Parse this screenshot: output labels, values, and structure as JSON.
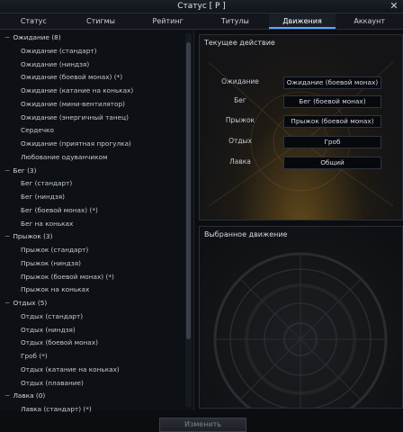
{
  "window": {
    "title": "Статус [ P ]",
    "close_icon": "close-icon"
  },
  "tabs": [
    {
      "label": "Статус",
      "active": false
    },
    {
      "label": "Стигмы",
      "active": false
    },
    {
      "label": "Рейтинг",
      "active": false
    },
    {
      "label": "Титулы",
      "active": false
    },
    {
      "label": "Движения",
      "active": true
    },
    {
      "label": "Аккаунт",
      "active": false
    }
  ],
  "motion_list": {
    "toggle_icon": "minus-icon",
    "groups": [
      {
        "label": "Ожидание (8)",
        "items": [
          "Ожидание (стандарт)",
          "Ожидание (ниндзя)",
          "Ожидание (боевой монах) (*)",
          "Ожидание (катание на коньках)",
          "Ожидание (мини-вентилятор)",
          "Ожидание (энергичный танец)",
          "Сердечко",
          "Ожидание (приятная прогулка)",
          "Любование одуванчиком"
        ]
      },
      {
        "label": "Бег (3)",
        "items": [
          "Бег (стандарт)",
          "Бег (ниндзя)",
          "Бег (боевой монах) (*)",
          "Бег на коньках"
        ]
      },
      {
        "label": "Прыжок (3)",
        "items": [
          "Прыжок (стандарт)",
          "Прыжок (ниндзя)",
          "Прыжок (боевой монах) (*)",
          "Прыжок на коньках"
        ]
      },
      {
        "label": "Отдых (5)",
        "items": [
          "Отдых (стандарт)",
          "Отдых (ниндзя)",
          "Отдых (боевой монах)",
          "Гроб (*)",
          "Отдых (катание на коньках)",
          "Отдых (плавание)"
        ]
      },
      {
        "label": "Лавка (0)",
        "items": [
          "Лавка (стандарт) (*)"
        ]
      }
    ]
  },
  "current_action": {
    "header": "Текущее действие",
    "rows": [
      {
        "label": "Ожидание",
        "value": "Ожидание (боевой монах)"
      },
      {
        "label": "Бег",
        "value": "Бег (боевой монах)"
      },
      {
        "label": "Прыжок",
        "value": "Прыжок (боевой монах)"
      },
      {
        "label": "Отдых",
        "value": "Гроб"
      },
      {
        "label": "Лавка",
        "value": "Общий"
      }
    ]
  },
  "selected_motion": {
    "header": "Выбранное движение"
  },
  "footer": {
    "apply_label": "Изменить"
  },
  "colors": {
    "accent": "#5aa8ff",
    "glow": "#a0731e"
  }
}
